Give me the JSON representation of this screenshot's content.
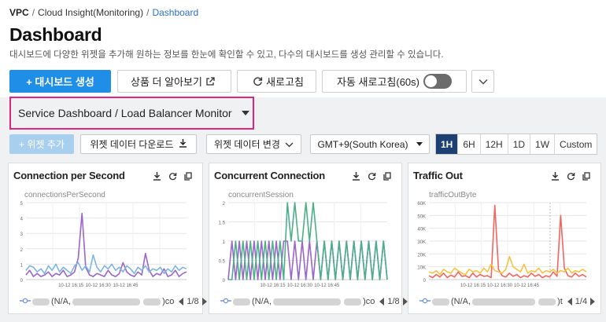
{
  "breadcrumb": {
    "root": "VPC",
    "middle": "Cloud Insight(Monitoring)",
    "current": "Dashboard"
  },
  "page": {
    "title": "Dashboard",
    "description": "대시보드에 다양한 위젯을 추가해 원하는 정보를 한눈에 확인할 수 있고, 다수의 대시보드를 생성 관리할 수 있습니다."
  },
  "toolbar": {
    "create_label": "+ 대시보드 생성",
    "learn_more_label": "상품 더 알아보기",
    "refresh_label": "새로고침",
    "auto_refresh_label": "자동 새로고침(60s)",
    "auto_refresh_on": false
  },
  "dashboard_select": {
    "value": "Service Dashboard / Load Balancer Monitor"
  },
  "subtoolbar": {
    "add_widget_label": "+ 위젯 추가",
    "download_label": "위젯 데이터 다운로드",
    "change_label": "위젯 데이터 변경",
    "timezone": "GMT+9(South Korea)",
    "ranges": [
      "1H",
      "6H",
      "12H",
      "1D",
      "1W",
      "Custom"
    ],
    "active_range": "1H"
  },
  "widgets": [
    {
      "title": "Connection per Second",
      "metric": "connectionsPerSecond",
      "y_ticks": [
        "5",
        "4",
        "3",
        "2",
        "1",
        "0"
      ],
      "x_ticks": [
        "10-12 16:15",
        "10-12 16:30",
        "10-12 16:45"
      ],
      "legend_prefix": "(N/A,",
      "legend_suffix": ")co",
      "page": "1/8"
    },
    {
      "title": "Concurrent Connection",
      "metric": "concurrentSession",
      "y_ticks": [
        "2",
        "1.5",
        "1",
        "0.5",
        "0"
      ],
      "x_ticks": [
        "10-12 16:15",
        "10-12 16:30",
        "10-12 16:45"
      ],
      "legend_prefix": "(N/A,",
      "legend_suffix": ")co",
      "page": "1/8"
    },
    {
      "title": "Traffic Out",
      "metric": "trafficOutByte",
      "y_ticks": [
        "60K",
        "50K",
        "40K",
        "30K",
        "20K",
        "10K",
        "0"
      ],
      "x_ticks": [
        "10-12 16:15",
        "10-12 16:30",
        "10-12 16:45"
      ],
      "legend_prefix": "(N/A,",
      "legend_suffix": ")t",
      "page": "1/4"
    }
  ],
  "chart_data": [
    {
      "type": "line",
      "title": "Connection per Second",
      "ylabel": "connectionsPerSecond",
      "ylim": [
        0,
        5
      ],
      "x": [
        "10-12 16:15",
        "10-12 16:30",
        "10-12 16:45"
      ],
      "series": [
        {
          "color": "#9966cc",
          "values": [
            0.3,
            0.6,
            0.2,
            0.4,
            0.2,
            0.3,
            0.5,
            0.2,
            0.4,
            0.3,
            0.6,
            0.2,
            0.3,
            0.5,
            1.4,
            4.3,
            0.8,
            0.3,
            0.2,
            0.4,
            0.3,
            0.2,
            0.6,
            0.3,
            0.2,
            0.4,
            1.1,
            0.5,
            0.3,
            0.2,
            0.5,
            0.3,
            1.7,
            0.6,
            0.2,
            0.4,
            0.3,
            0.7,
            0.2,
            0.3,
            0.6,
            0.2,
            0.4,
            0.5
          ]
        },
        {
          "color": "#7cb6e0",
          "values": [
            0.6,
            0.9,
            0.8,
            0.5,
            0.7,
            0.4,
            0.9,
            0.6,
            1.0,
            0.5,
            0.8,
            0.6,
            0.4,
            0.9,
            1.1,
            0.6,
            0.9,
            0.5,
            1.6,
            0.8,
            0.5,
            0.9,
            0.7,
            1.0,
            0.6,
            0.8,
            0.5,
            0.9,
            0.7,
            0.4,
            0.8,
            0.6,
            0.9,
            0.5,
            0.7,
            0.6,
            0.8,
            0.4,
            0.7,
            0.5,
            0.9,
            0.6,
            0.8,
            0.7
          ]
        }
      ]
    },
    {
      "type": "line",
      "title": "Concurrent Connection",
      "ylabel": "concurrentSession",
      "ylim": [
        0,
        2
      ],
      "x": [
        "10-12 16:15",
        "10-12 16:30",
        "10-12 16:45"
      ],
      "series": [
        {
          "color": "#9966cc",
          "values": [
            0,
            1,
            0,
            1,
            0,
            1,
            0,
            1,
            0,
            1,
            0,
            1,
            0,
            1,
            0,
            1,
            1,
            0,
            1,
            0,
            1,
            0,
            1,
            0,
            1,
            0,
            1,
            0,
            1,
            0,
            1,
            0,
            1,
            0,
            1,
            0,
            1,
            0,
            1,
            0,
            1,
            0,
            1,
            0
          ]
        },
        {
          "color": "#4caf8a",
          "values": [
            0,
            0,
            1,
            0,
            1,
            0,
            1,
            0,
            1,
            0,
            1,
            0,
            1,
            0,
            1,
            0,
            2,
            1,
            2,
            1,
            1,
            2,
            1,
            2,
            1,
            0,
            1,
            0,
            1,
            0,
            1,
            0,
            1,
            0,
            1,
            0,
            1,
            0,
            1,
            0,
            1,
            0,
            1,
            0
          ]
        }
      ]
    },
    {
      "type": "line",
      "title": "Traffic Out",
      "ylabel": "trafficOutByte",
      "ylim": [
        0,
        60000
      ],
      "x": [
        "10-12 16:15",
        "10-12 16:30",
        "10-12 16:45"
      ],
      "series": [
        {
          "color": "#f2665e",
          "values": [
            3000,
            1500,
            4000,
            2000,
            5000,
            1500,
            3500,
            2000,
            6000,
            2500,
            3000,
            1500,
            5000,
            2000,
            4000,
            2500,
            3000,
            1500,
            58000,
            8000,
            3000,
            2000,
            5000,
            2500,
            4000,
            1500,
            3000,
            2000,
            5000,
            2500,
            4000,
            1500,
            3000,
            2000,
            6000,
            2500,
            50000,
            9000,
            3000,
            2000,
            5000,
            2500,
            4000,
            2000
          ]
        },
        {
          "color": "#f5c242",
          "values": [
            6000,
            5000,
            7000,
            4000,
            8000,
            6000,
            5000,
            9000,
            7000,
            5000,
            4000,
            8000,
            6000,
            7000,
            5000,
            9000,
            6000,
            12000,
            7000,
            6000,
            5000,
            8000,
            18000,
            10000,
            8000,
            6000,
            12000,
            5000,
            7000,
            6000,
            9000,
            5000,
            7000,
            6000,
            8000,
            5000,
            7000,
            6000,
            9000,
            5000,
            7000,
            6000,
            8000,
            6000
          ]
        }
      ]
    }
  ],
  "colors": {
    "primary": "#1f8ee6",
    "highlight": "#e0267c",
    "range_active": "#1d3f72"
  }
}
